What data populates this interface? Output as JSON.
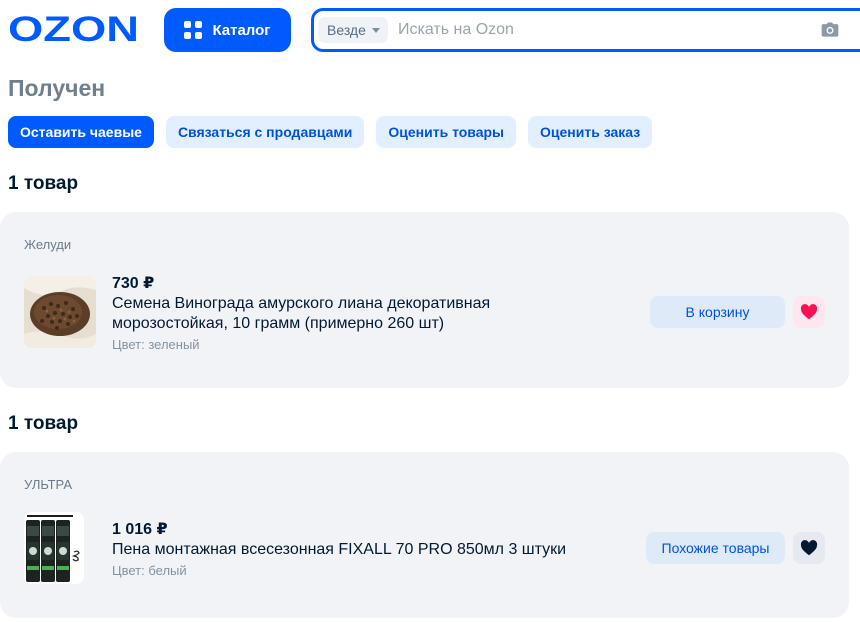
{
  "header": {
    "logo_text": "OZON",
    "catalog_label": "Каталог",
    "search": {
      "scope_label": "Везде",
      "placeholder": "Искать на Ozon"
    }
  },
  "order": {
    "status_title": "Получен",
    "actions": [
      {
        "label": "Оставить чаевые"
      },
      {
        "label": "Связаться с продавцами"
      },
      {
        "label": "Оценить товары"
      },
      {
        "label": "Оценить заказ"
      }
    ]
  },
  "groups": [
    {
      "count_label": "1 товар",
      "seller": "Желуди",
      "item": {
        "price": "730 ₽",
        "name_line1": "Семена Винограда амурского лиана декоративная",
        "name_line2": "морозостойкая, 10 грамм (примерно 260 шт)",
        "attribute": "Цвет: зеленый",
        "action_label": "В корзину",
        "favorite": true
      }
    },
    {
      "count_label": "1 товар",
      "seller": "УЛЬТРА",
      "item": {
        "price": "1 016 ₽",
        "name_line1": "Пена монтажная всесезонная FIXALL 70 PRO 850мл 3 штуки",
        "attribute": "Цвет: белый",
        "action_label": "Похожие товары",
        "favorite": false
      }
    }
  ],
  "colors": {
    "brand_blue": "#005bff",
    "favorite_pink": "#f91155",
    "favorite_dark": "#001a34"
  }
}
